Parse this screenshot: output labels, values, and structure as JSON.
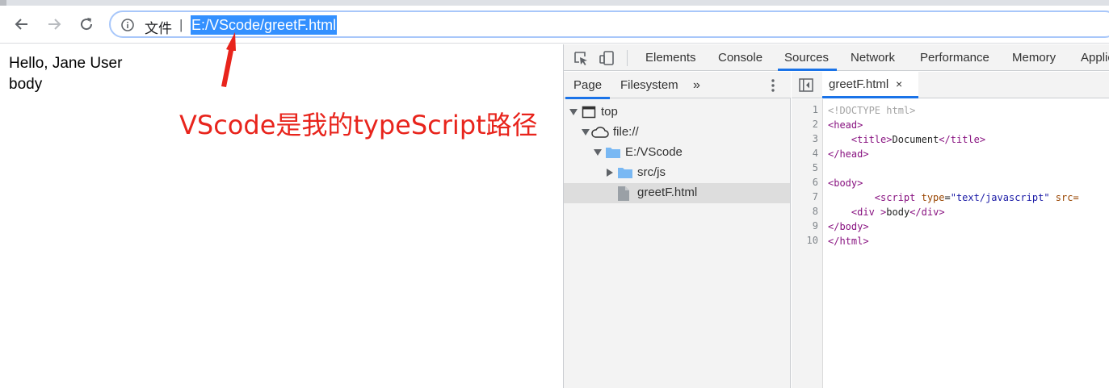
{
  "browser": {
    "omnibox": {
      "label": "文件",
      "separator": "|",
      "url": "E:/VScode/greetF.html"
    }
  },
  "page": {
    "lines": [
      "Hello, Jane User",
      "body"
    ],
    "annotation": "VScode是我的typeScript路径",
    "annotation_color": "#e8241c"
  },
  "devtools": {
    "tabs": [
      "Elements",
      "Console",
      "Sources",
      "Network",
      "Performance",
      "Memory",
      "Applic"
    ],
    "active_tab": "Sources",
    "navigator": {
      "tabs": [
        "Page",
        "Filesystem"
      ],
      "more": "»",
      "tree": [
        {
          "label": "top",
          "icon": "frame-icon",
          "expanded": true,
          "depth": 0
        },
        {
          "label": "file://",
          "icon": "cloud-icon",
          "expanded": true,
          "depth": 1
        },
        {
          "label": "E:/VScode",
          "icon": "folder-icon",
          "expanded": true,
          "depth": 2
        },
        {
          "label": "src/js",
          "icon": "folder-icon",
          "expanded": false,
          "depth": 3
        },
        {
          "label": "greetF.html",
          "icon": "file-icon",
          "selected": true,
          "depth": 3
        }
      ]
    },
    "editor": {
      "tab": "greetF.html",
      "close": "×",
      "line_numbers": [
        "1",
        "2",
        "3",
        "4",
        "5",
        "6",
        "7",
        "8",
        "9",
        "10"
      ],
      "lines": [
        "<!DOCTYPE html>",
        "<head>",
        "    <title>Document</title>",
        "</head>",
        "",
        "<body>",
        "        <script type=\"text/javascript\" src=",
        "    <div >body</div>",
        "</body>",
        "</html>"
      ]
    },
    "accent": "#1a73e8"
  }
}
